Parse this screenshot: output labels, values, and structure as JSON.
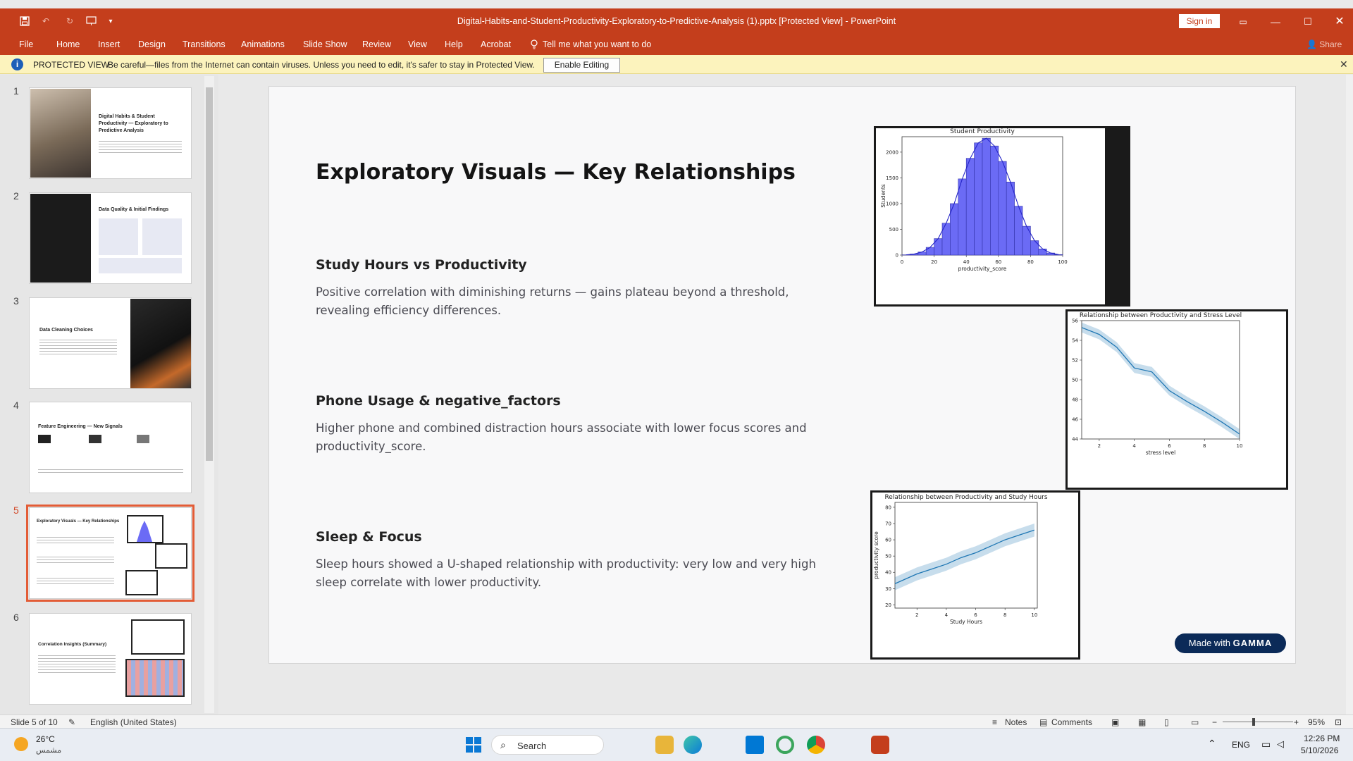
{
  "window": {
    "doc_title": "Digital-Habits-and-Student-Productivity-Exploratory-to-Predictive-Analysis (1).pptx [Protected View]  -  PowerPoint",
    "sign_in": "Sign in",
    "share": "Share"
  },
  "ribbon": {
    "tabs": [
      "File",
      "Home",
      "Insert",
      "Design",
      "Transitions",
      "Animations",
      "Slide Show",
      "Review",
      "View",
      "Help",
      "Acrobat"
    ],
    "tell_me": "Tell me what you want to do"
  },
  "protected": {
    "label": "PROTECTED VIEW",
    "message": "Be careful—files from the Internet can contain viruses. Unless you need to edit, it's safer to stay in Protected View.",
    "enable_button": "Enable Editing"
  },
  "thumbnails": [
    {
      "num": "1",
      "title": "Digital Habits & Student Productivity — Exploratory to Predictive Analysis"
    },
    {
      "num": "2",
      "title": "Data Quality & Initial Findings"
    },
    {
      "num": "3",
      "title": "Data Cleaning Choices"
    },
    {
      "num": "4",
      "title": "Feature Engineering — New Signals"
    },
    {
      "num": "5",
      "title": "Exploratory Visuals — Key Relationships"
    },
    {
      "num": "6",
      "title": "Correlation Insights (Summary)"
    }
  ],
  "slide": {
    "title": "Exploratory Visuals — Key Relationships",
    "sections": [
      {
        "heading": "Study Hours vs Productivity",
        "body": "Positive correlation with diminishing returns — gains plateau beyond a threshold, revealing efficiency differences."
      },
      {
        "heading": "Phone Usage & negative_factors",
        "body": "Higher phone and combined distraction hours associate with lower focus scores and productivity_score."
      },
      {
        "heading": "Sleep & Focus",
        "body": "Sleep hours showed a U-shaped relationship with productivity: very low and very high sleep correlate with lower productivity."
      }
    ],
    "badge_prefix": "Made with",
    "badge_brand": "GAMMA"
  },
  "chart_data": [
    {
      "type": "bar",
      "title": "Student Productivity",
      "xlabel": "productivity_score",
      "ylabel": "Students",
      "xlim": [
        0,
        100
      ],
      "ylim": [
        0,
        2300
      ],
      "xticks": [
        "0",
        "20",
        "40",
        "60",
        "80",
        "100"
      ],
      "yticks": [
        "0",
        "500",
        "1000",
        "1500",
        "2000"
      ],
      "bin_width": 5,
      "x": [
        2.5,
        7.5,
        12.5,
        17.5,
        22.5,
        27.5,
        32.5,
        37.5,
        42.5,
        47.5,
        52.5,
        57.5,
        62.5,
        67.5,
        72.5,
        77.5,
        82.5,
        87.5,
        92.5,
        97.5
      ],
      "values": [
        5,
        20,
        60,
        150,
        320,
        620,
        1000,
        1480,
        1880,
        2180,
        2270,
        2120,
        1820,
        1420,
        950,
        560,
        280,
        120,
        40,
        10
      ],
      "color": "#6b6bf5"
    },
    {
      "type": "line",
      "title": "Relationship between Productivity and Stress Level",
      "xlabel": "stress level",
      "ylabel": "productivity score",
      "xlim": [
        1,
        10
      ],
      "ylim": [
        44,
        56
      ],
      "xticks": [
        "2",
        "4",
        "6",
        "8",
        "10"
      ],
      "yticks": [
        "44",
        "46",
        "48",
        "50",
        "52",
        "54",
        "56"
      ],
      "x": [
        1,
        2,
        3,
        4,
        5,
        6,
        7,
        8,
        9,
        10
      ],
      "values": [
        55.3,
        54.6,
        53.3,
        51.2,
        50.8,
        48.9,
        47.8,
        46.8,
        45.7,
        44.5
      ],
      "band": 0.5,
      "color": "#1f77b4"
    },
    {
      "type": "line",
      "title": "Relationship between Productivity and Study Hours",
      "xlabel": "Study Hours",
      "ylabel": "productivity score",
      "xlim": [
        0.5,
        10.2
      ],
      "ylim": [
        18,
        83
      ],
      "xticks": [
        "2",
        "4",
        "6",
        "8",
        "10"
      ],
      "yticks": [
        "20",
        "30",
        "40",
        "50",
        "60",
        "70",
        "80"
      ],
      "x": [
        0.5,
        1,
        2,
        3,
        4,
        5,
        6,
        7,
        8,
        9,
        10
      ],
      "values": [
        33,
        35,
        39,
        42,
        45,
        49,
        52,
        56,
        60,
        63,
        66
      ],
      "band": 4,
      "color": "#1f77b4"
    }
  ],
  "status": {
    "slide_of": "Slide 5 of 10",
    "language": "English (United States)",
    "notes": "Notes",
    "comments": "Comments",
    "zoom": "95%"
  },
  "taskbar": {
    "weather_temp": "26°C",
    "weather_desc": "مشمس",
    "search": "Search",
    "lang": "ENG",
    "time": "12:26 PM",
    "date": "5/10/2026"
  }
}
